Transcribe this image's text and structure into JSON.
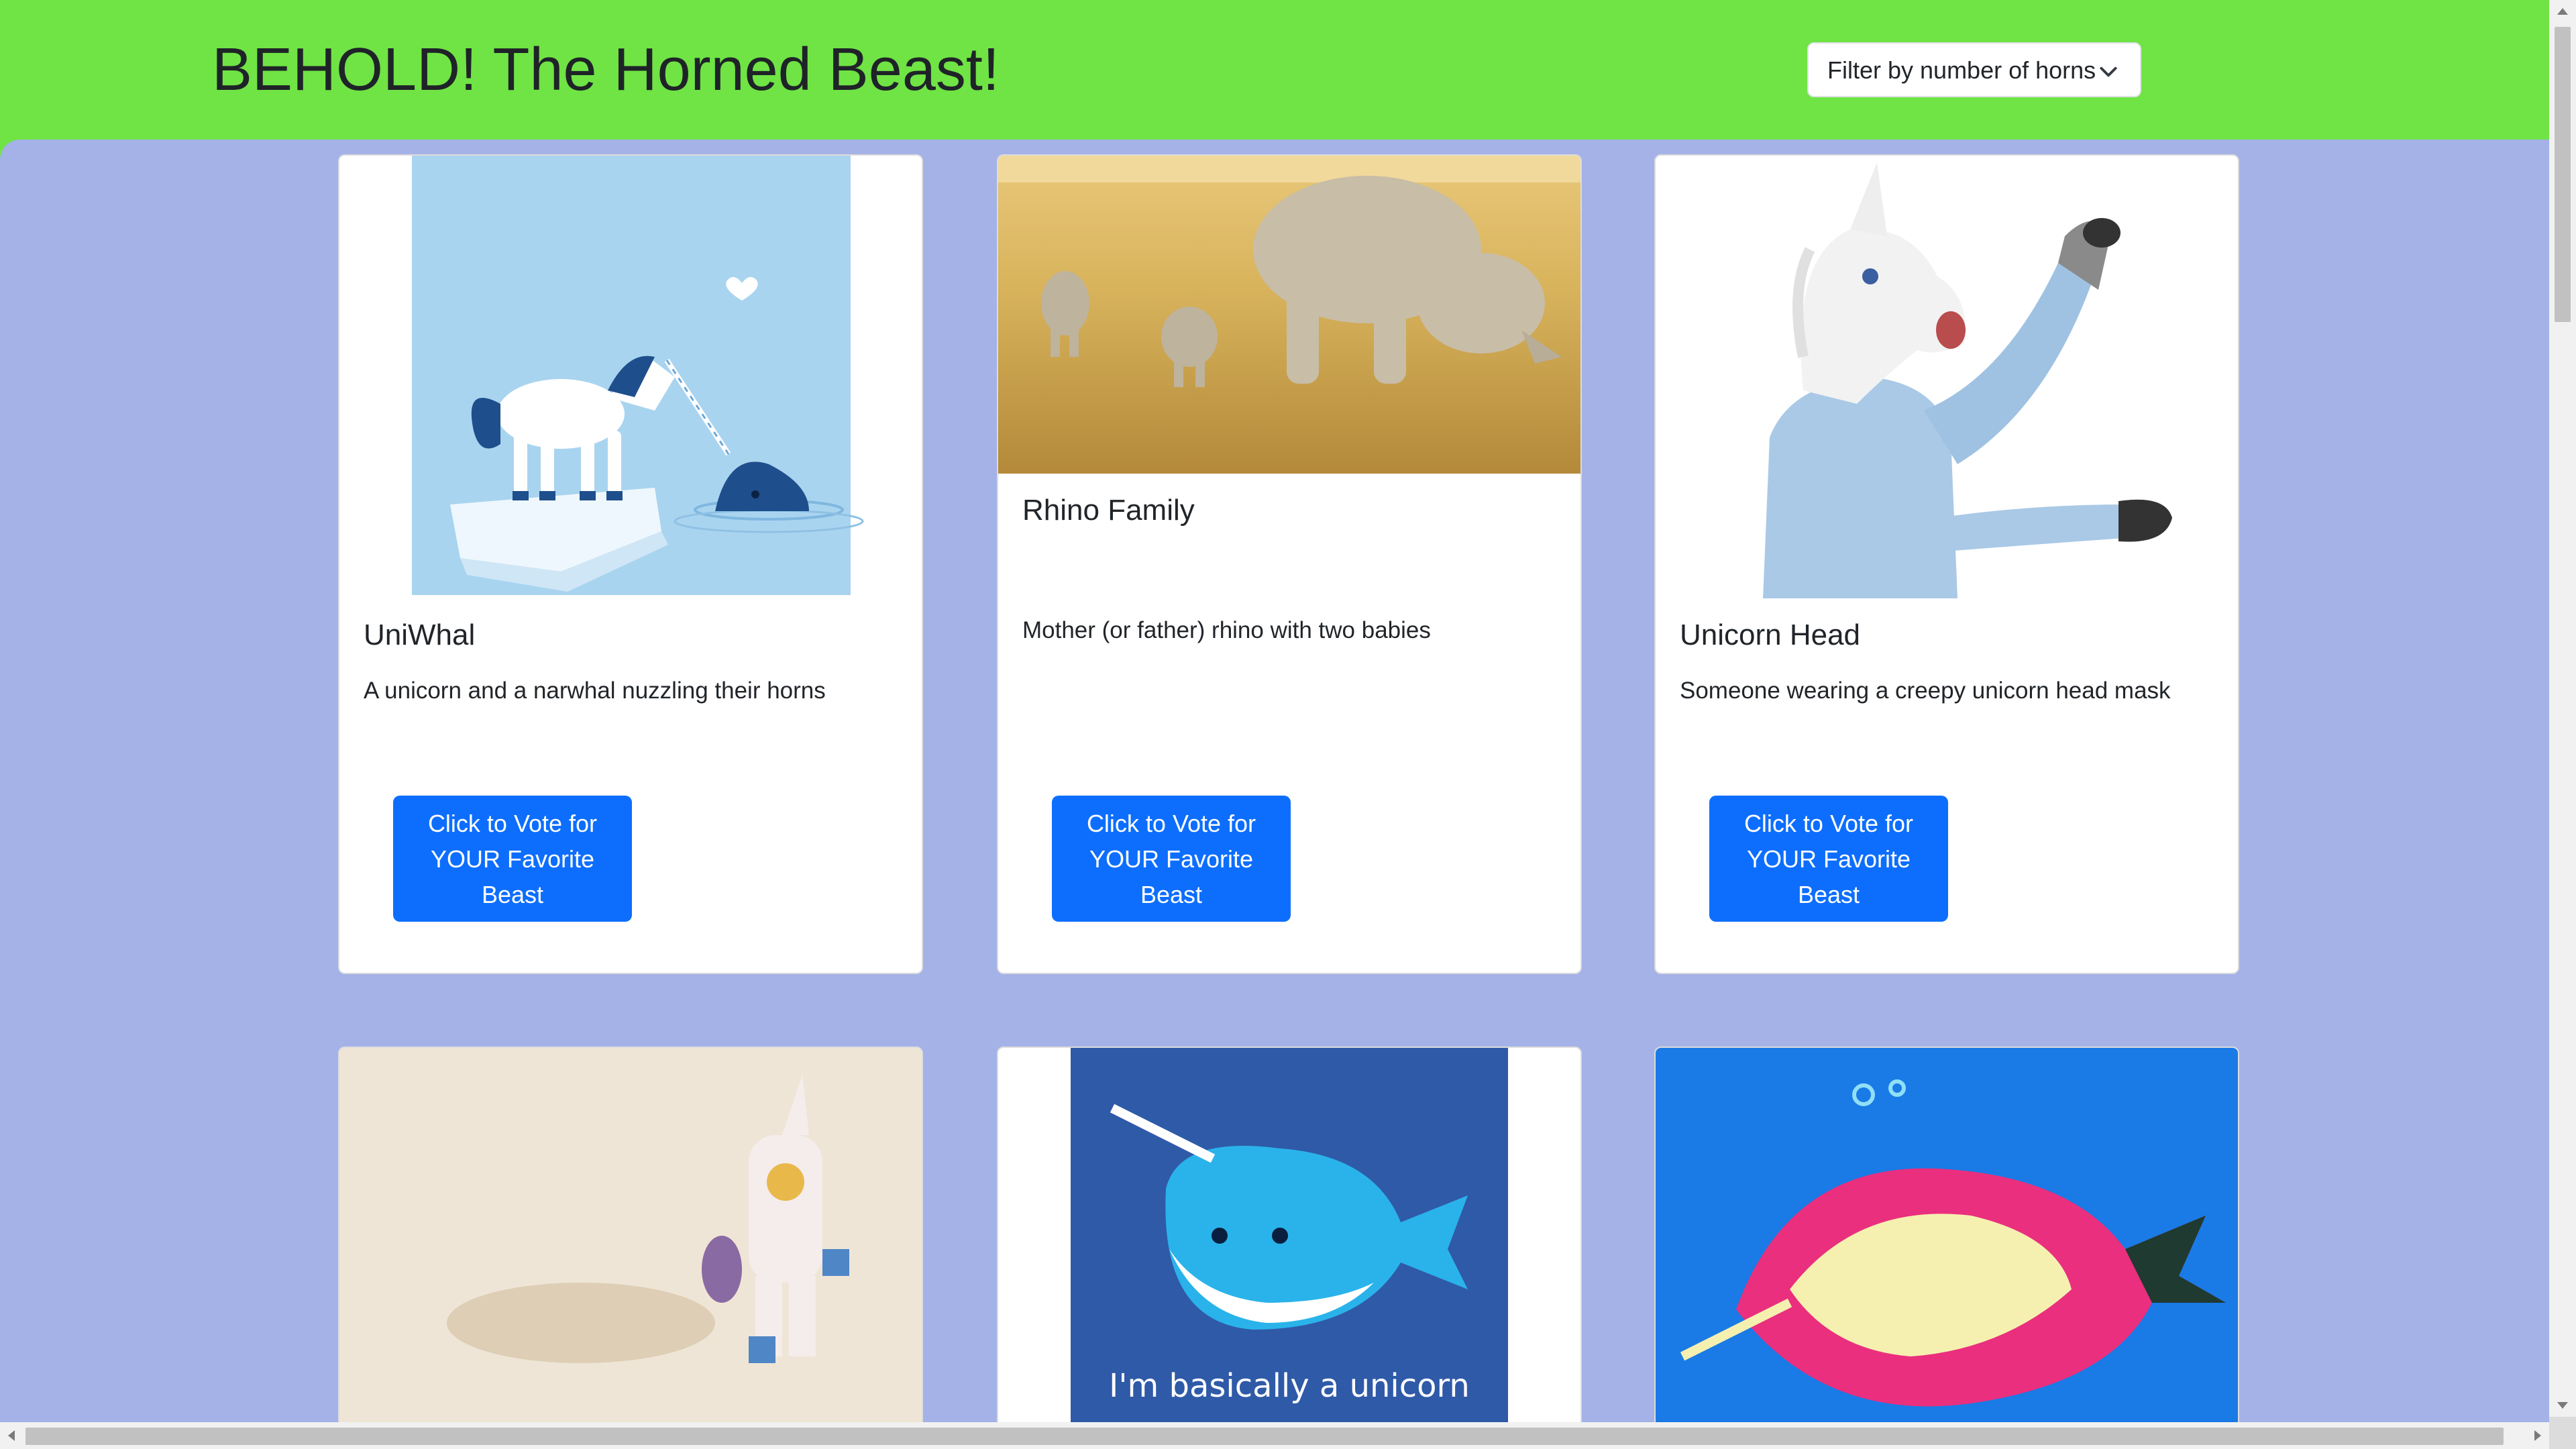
{
  "header": {
    "title": "BEHOLD! The Horned Beast!",
    "filter_label": "Filter by number of horns",
    "filter_icon": "chevron-down-icon"
  },
  "colors": {
    "header_bg": "#6fe444",
    "page_bg": "#a4b2e7",
    "button_bg": "#0d6efd"
  },
  "cards": [
    {
      "title": "UniWhal",
      "description": "A unicorn and a narwhal nuzzling their horns",
      "button": "Click to Vote for YOUR Favorite Beast"
    },
    {
      "title": "Rhino Family",
      "description": "Mother (or father) rhino with two babies",
      "button": "Click to Vote for YOUR Favorite Beast"
    },
    {
      "title": "Unicorn Head",
      "description": "Someone wearing a creepy unicorn head mask",
      "button": "Click to Vote for YOUR Favorite Beast"
    }
  ],
  "bottom_cards": [
    {
      "image": "unicorn-lego-figure-image"
    },
    {
      "image": "narwhal-cartoon-image",
      "caption": "I'm basically a unicorn"
    },
    {
      "image": "narwhal-drawing-image"
    }
  ]
}
